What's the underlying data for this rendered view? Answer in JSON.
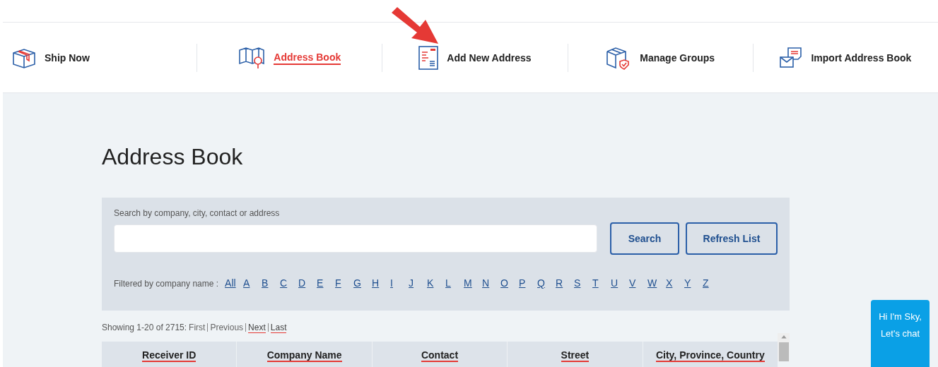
{
  "nav": [
    {
      "label": "Ship Now",
      "selected": false
    },
    {
      "label": "Address Book",
      "selected": true
    },
    {
      "label": "Add New Address",
      "selected": false
    },
    {
      "label": "Manage Groups",
      "selected": false
    },
    {
      "label": "Import Address Book",
      "selected": false
    }
  ],
  "page_title": "Address Book",
  "search": {
    "label": "Search by company, city, contact or address",
    "buttons": [
      "Search",
      "Refresh List"
    ]
  },
  "filter": {
    "label": "Filtered by company name :",
    "letters": [
      "All",
      "A",
      "B",
      "C",
      "D",
      "E",
      "F",
      "G",
      "H",
      "I",
      "J",
      "K",
      "L",
      "M",
      "N",
      "O",
      "P",
      "Q",
      "R",
      "S",
      "T",
      "U",
      "V",
      "W",
      "X",
      "Y",
      "Z"
    ]
  },
  "pager": {
    "summary": "Showing 1-20 of 2715:",
    "links": [
      {
        "label": "First",
        "enabled": false
      },
      {
        "label": "Previous",
        "enabled": false
      },
      {
        "label": "Next",
        "enabled": true
      },
      {
        "label": "Last",
        "enabled": true
      }
    ]
  },
  "table": {
    "columns": [
      "Receiver ID",
      "Company Name",
      "Contact",
      "Street",
      "City, Province, Country"
    ]
  },
  "chat": {
    "label": "Hi I'm Sky, Let's chat"
  }
}
